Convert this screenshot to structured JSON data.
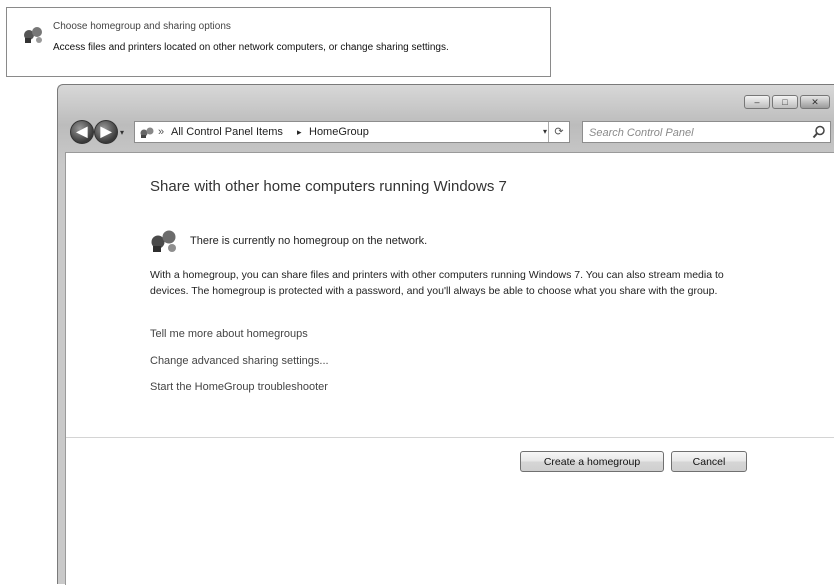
{
  "callout": {
    "title": "Choose homegroup and sharing options",
    "description": "Access files and printers located on other network computers, or change sharing settings."
  },
  "window": {
    "controls": {
      "minimize": "–",
      "maximize": "□",
      "close": "✕"
    }
  },
  "navigation": {
    "back_glyph": "◀",
    "forward_glyph": "▶",
    "address": {
      "separator": "»",
      "segments": [
        "All Control Panel Items",
        "HomeGroup"
      ],
      "arrow": "▸",
      "dropdown": "▾",
      "refresh": "⟳"
    },
    "search": {
      "placeholder": "Search Control Panel"
    }
  },
  "main": {
    "heading": "Share with other home computers running Windows 7",
    "status": "There is currently no homegroup on the network.",
    "description": "With a homegroup, you can share files and printers with other computers running Windows 7. You can also stream media to devices. The homegroup is protected with a password, and you'll always be able to choose what you share with the group.",
    "links": [
      "Tell me more about homegroups",
      "Change advanced sharing settings...",
      "Start the HomeGroup troubleshooter"
    ]
  },
  "buttons": {
    "create": "Create a homegroup",
    "cancel": "Cancel"
  },
  "icons": [
    "homegroup-icon",
    "back-arrow-icon",
    "forward-arrow-icon",
    "control-panel-icon",
    "refresh-icon",
    "search-icon",
    "minimize-icon",
    "maximize-icon",
    "close-icon"
  ]
}
